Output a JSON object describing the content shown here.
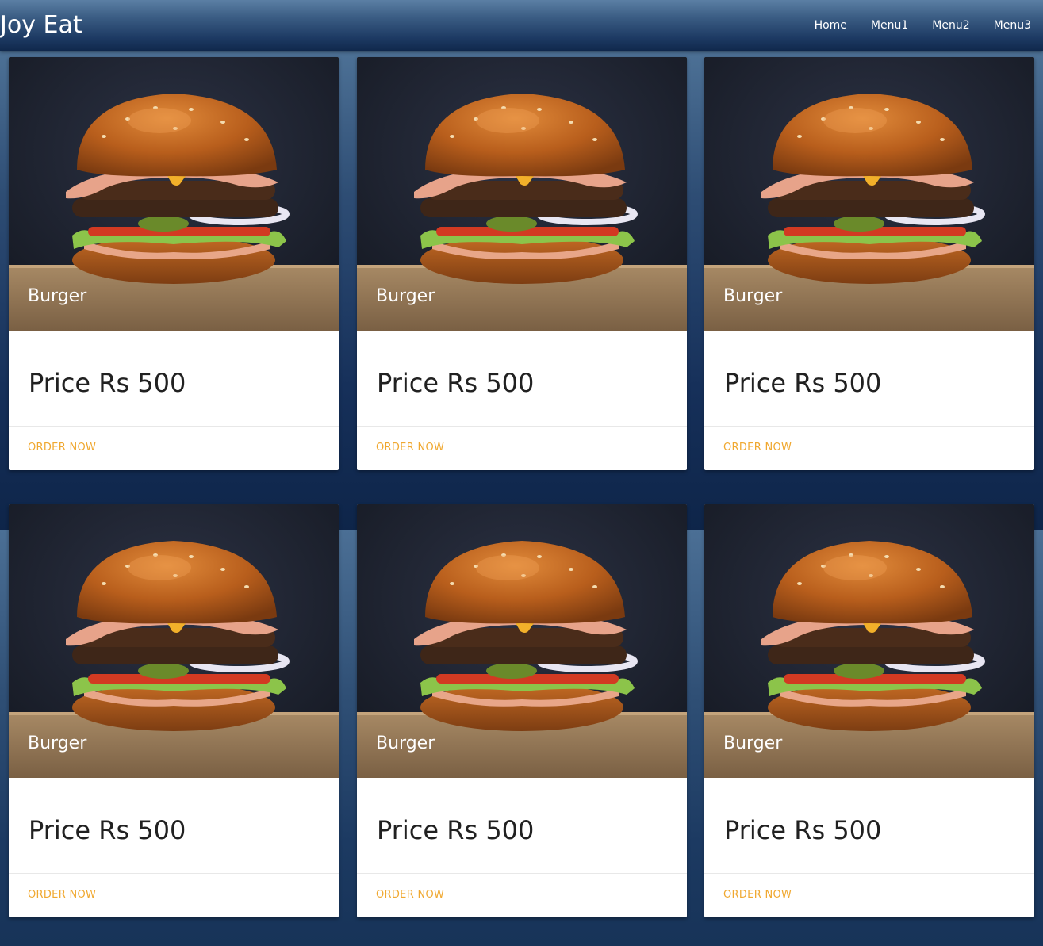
{
  "navbar": {
    "brand": "Joy Eat",
    "links": [
      "Home",
      "Menu1",
      "Menu2",
      "Menu3"
    ]
  },
  "cards": [
    {
      "title": "Burger",
      "price": "Price Rs 500",
      "action": "ORDER NOW",
      "image": "burger-photo"
    },
    {
      "title": "Burger",
      "price": "Price Rs 500",
      "action": "ORDER NOW",
      "image": "burger-photo"
    },
    {
      "title": "Burger",
      "price": "Price Rs 500",
      "action": "ORDER NOW",
      "image": "burger-photo"
    },
    {
      "title": "Burger",
      "price": "Price Rs 500",
      "action": "ORDER NOW",
      "image": "burger-photo"
    },
    {
      "title": "Burger",
      "price": "Price Rs 500",
      "action": "ORDER NOW",
      "image": "burger-photo"
    },
    {
      "title": "Burger",
      "price": "Price Rs 500",
      "action": "ORDER NOW",
      "image": "burger-photo"
    }
  ],
  "colors": {
    "accent": "#f0a830",
    "navbar": "#1d3a63",
    "card": "#ffffff",
    "price_text": "#212121"
  }
}
